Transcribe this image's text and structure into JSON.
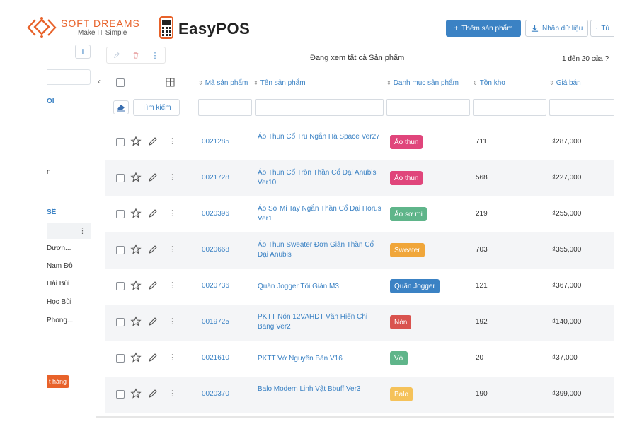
{
  "logos": {
    "softdreams_title": "SOFT DREAMS",
    "softdreams_tagline": "Make IT Simple",
    "easypos_title": "EasyPOS"
  },
  "topbar": {
    "add_product": "Thêm sản phẩm",
    "import_data": "Nhập dữ liệu",
    "more": "Tù"
  },
  "sidebar": {
    "heading1": "ÔI",
    "item_a": "n",
    "heading2": "SẼ",
    "people": [
      "Dươn...",
      "Nam Đỗ",
      "Hải Bùi",
      "Học Bùi",
      "Phong..."
    ],
    "badge": "t hàng"
  },
  "toolbar": {
    "viewing": "Đang xem tất cả Sản phẩm",
    "pager": "1 đến 20 của ?"
  },
  "grid": {
    "headers": [
      "Mã sản phẩm",
      "Tên sản phẩm",
      "Danh mục sản phẩm",
      "Tồn kho",
      "Giá bán"
    ],
    "search_label": "Tìm kiếm"
  },
  "colors": {
    "primary": "#3b82c4",
    "brand_orange": "#e8622a",
    "tag_pink": "#e0457b",
    "tag_green": "#5fb58a",
    "tag_orange": "#f0a63a",
    "tag_blue": "#3b82c4",
    "tag_red": "#d9534f",
    "tag_yellow": "#f5c25a"
  },
  "products": [
    {
      "code": "0021285",
      "name": "Áo Thun Cổ Tru Ngắn Hà Space Ver27",
      "category": "Áo thun",
      "category_color": "#e0457b",
      "stock": "711",
      "price": "₫287,000"
    },
    {
      "code": "0021728",
      "name": "Áo Thun Cổ Tròn Thần Cổ Đại Anubis Ver10",
      "category": "Áo thun",
      "category_color": "#e0457b",
      "stock": "568",
      "price": "₫227,000"
    },
    {
      "code": "0020396",
      "name": "Áo Sơ Mi Tay Ngắn Thần Cổ Đại Horus Ver1",
      "category": "Áo sơ mi",
      "category_color": "#5fb58a",
      "stock": "219",
      "price": "₫255,000"
    },
    {
      "code": "0020668",
      "name": "Áo Thun Sweater Đơn Giản Thần Cổ Đại Anubis",
      "category": "Sweater",
      "category_color": "#f0a63a",
      "stock": "703",
      "price": "₫355,000"
    },
    {
      "code": "0020736",
      "name": "Quần Jogger Tối Giản M3",
      "category": "Quần Jogger",
      "category_color": "#3b82c4",
      "stock": "121",
      "price": "₫367,000"
    },
    {
      "code": "0019725",
      "name": "PKTT Nón 12VAHDT Văn Hiến Chi Bang Ver2",
      "category": "Nón",
      "category_color": "#d9534f",
      "stock": "192",
      "price": "₫140,000"
    },
    {
      "code": "0021610",
      "name": "PKTT Vớ Nguyên Bản V16",
      "category": "Vớ",
      "category_color": "#5fb58a",
      "stock": "20",
      "price": "₫37,000"
    },
    {
      "code": "0020370",
      "name": "Balo Modern Linh Vật Bbuff Ver3",
      "category": "Balo",
      "category_color": "#f5c25a",
      "stock": "190",
      "price": "₫399,000"
    }
  ]
}
